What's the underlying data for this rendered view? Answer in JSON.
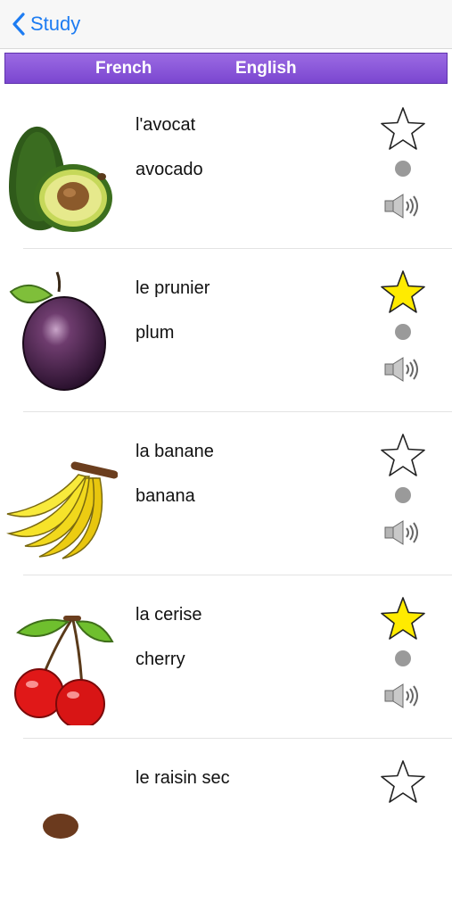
{
  "nav": {
    "back_label": "Study"
  },
  "segments": {
    "french": "French",
    "english": "English"
  },
  "colors": {
    "accent_blue": "#1d7cf2",
    "segment_purple": "#8a58dc",
    "star_fill": "#ffeb00"
  },
  "cards": [
    {
      "french": "l'avocat",
      "english": "avocado",
      "starred": false,
      "image": "avocado-image"
    },
    {
      "french": "le prunier",
      "english": "plum",
      "starred": true,
      "image": "plum-image"
    },
    {
      "french": "la banane",
      "english": "banana",
      "starred": false,
      "image": "banana-image"
    },
    {
      "french": "la cerise",
      "english": "cherry",
      "starred": true,
      "image": "cherry-image"
    },
    {
      "french": "le raisin sec",
      "english": "",
      "starred": false,
      "image": "raisin-image"
    }
  ]
}
